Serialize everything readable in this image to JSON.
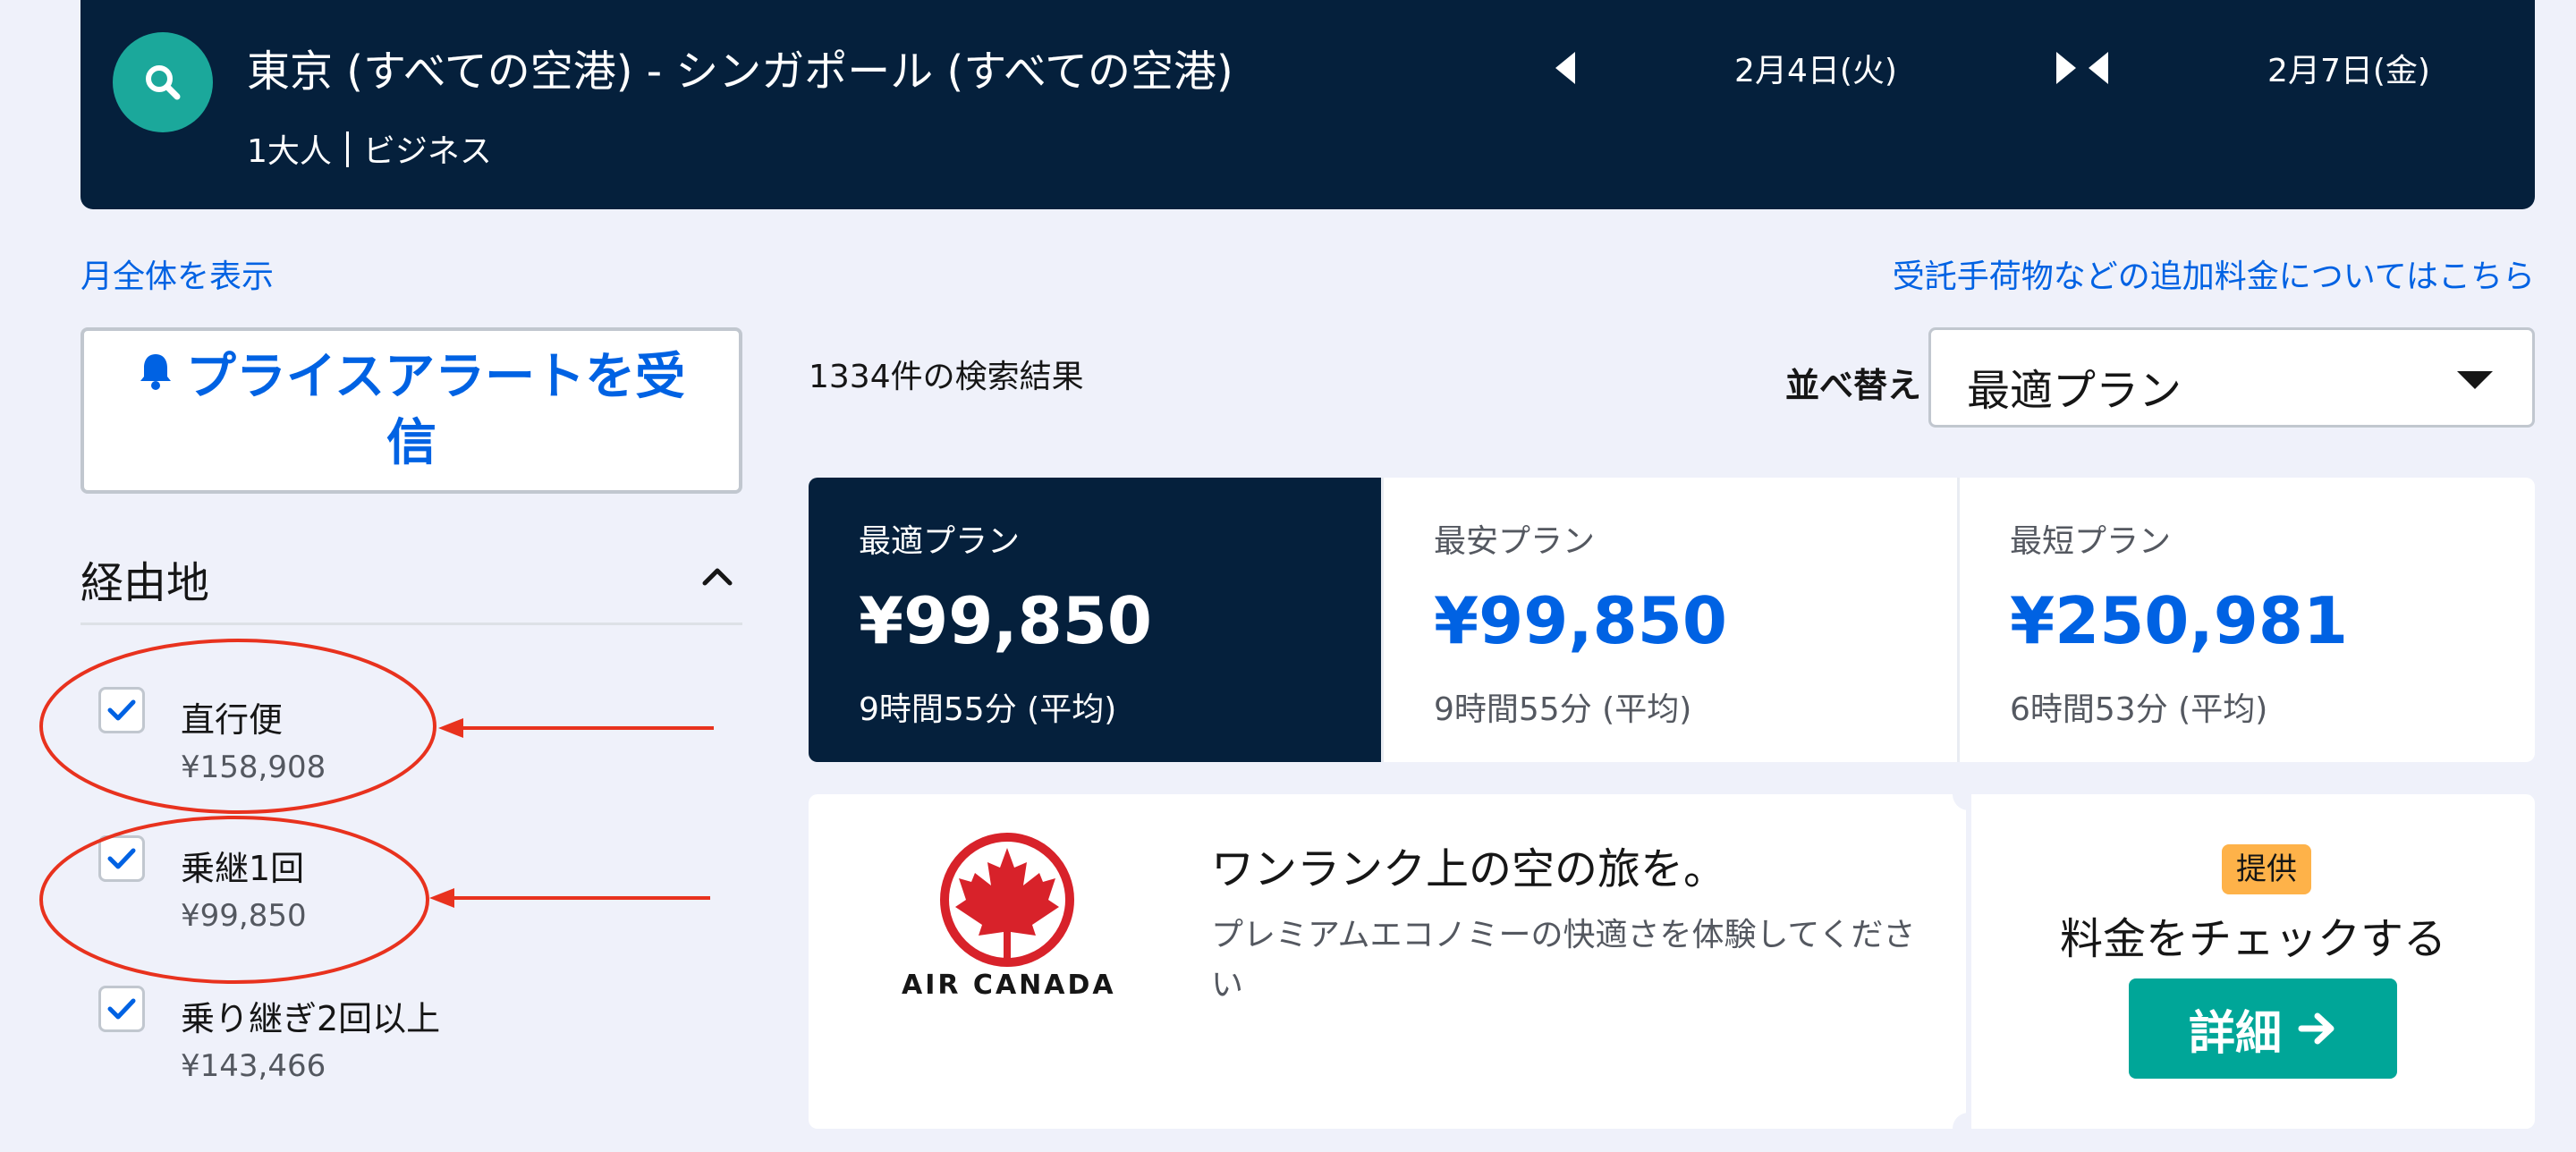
{
  "search": {
    "route": "東京 (すべての空港) - シンガポール (すべての空港)",
    "passengers": "1大人",
    "cabin": "ビジネス",
    "depart_date": "2月4日(火)",
    "return_date": "2月7日(金)"
  },
  "links": {
    "show_month": "月全体を表示",
    "extra_fees": "受託手荷物などの追加料金についてはこちら"
  },
  "price_alert": {
    "label": "プライスアラートを受信"
  },
  "stops_filter": {
    "title": "経由地",
    "options": [
      {
        "label": "直行便",
        "price": "¥158,908",
        "checked": true
      },
      {
        "label": "乗継1回",
        "price": "¥99,850",
        "checked": true
      },
      {
        "label": "乗り継ぎ2回以上",
        "price": "¥143,466",
        "checked": true
      }
    ]
  },
  "results": {
    "count": "1334件の検索結果",
    "sort_label": "並べ替え",
    "sort_value": "最適プラン"
  },
  "tabs": [
    {
      "name": "最適プラン",
      "price": "¥99,850",
      "duration": "9時間55分 (平均)",
      "active": true
    },
    {
      "name": "最安プラン",
      "price": "¥99,850",
      "duration": "9時間55分 (平均)",
      "active": false
    },
    {
      "name": "最短プラン",
      "price": "¥250,981",
      "duration": "6時間53分 (平均)",
      "active": false
    }
  ],
  "ad": {
    "brand": "AIR CANADA",
    "title": "ワンランク上の空の旅を。",
    "description": "プレミアムエコノミーの快適さを体験してください",
    "badge": "提供",
    "cta_title": "料金をチェックする",
    "cta_button": "詳細"
  },
  "colors": {
    "header_bg": "#05203c",
    "accent_blue": "#0062e3",
    "teal": "#00a698",
    "badge": "#feb249",
    "annotation_red": "#e8321e"
  }
}
